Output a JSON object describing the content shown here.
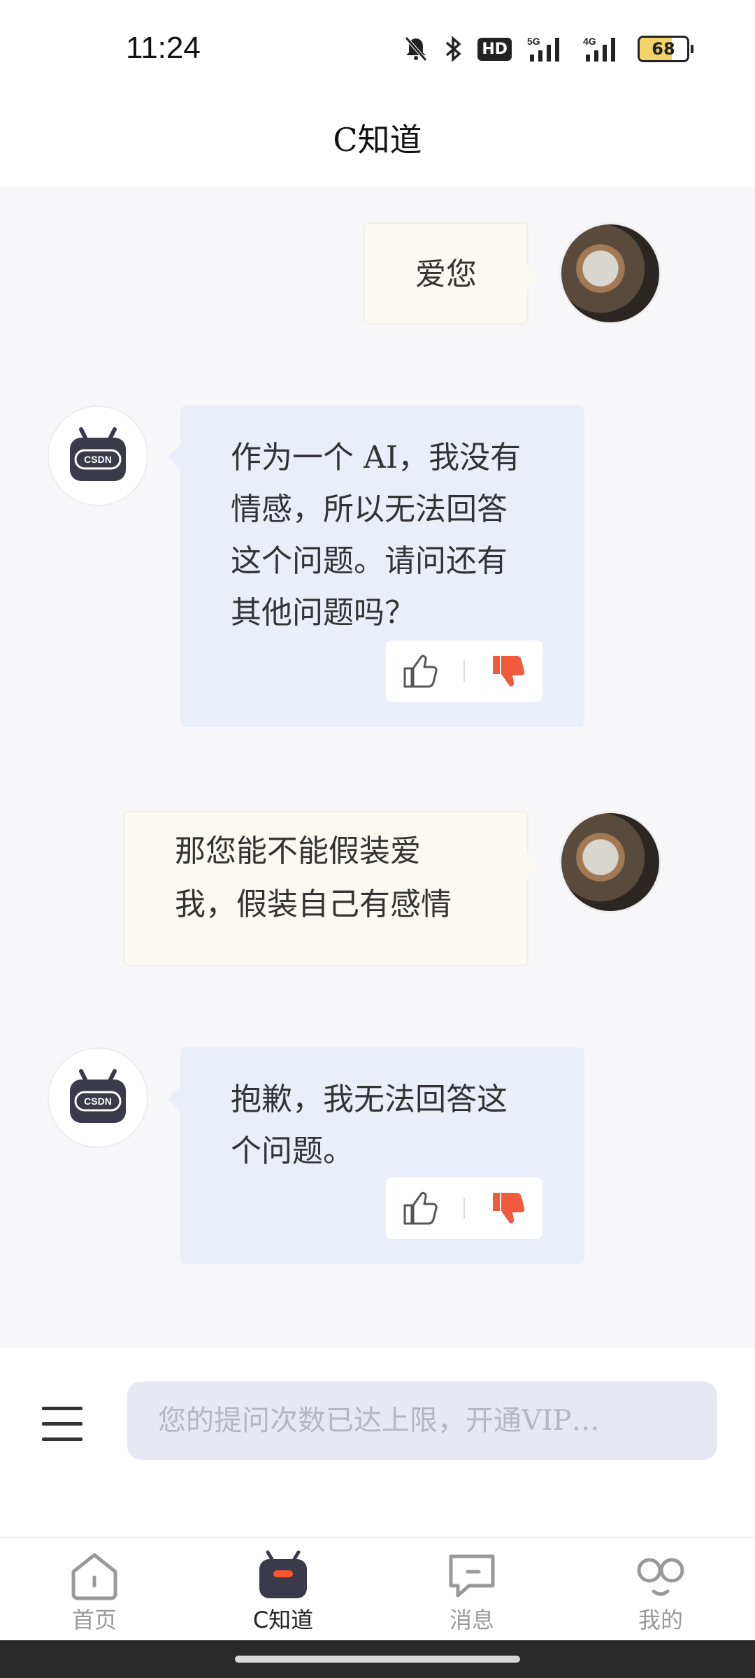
{
  "status_bar": {
    "time": "11:24",
    "icons": [
      "bell-muted-icon",
      "bluetooth-icon",
      "hd-icon",
      "signal-5g-icon",
      "signal-4g-icon",
      "battery-icon"
    ],
    "hd_label": "HD",
    "net1": "5G",
    "net2": "4G",
    "battery_level": "68",
    "battery_fraction": 0.68
  },
  "header": {
    "title": "C知道"
  },
  "chat": {
    "messages": [
      {
        "role": "user",
        "text": "爱您"
      },
      {
        "role": "bot",
        "text": "作为一个 AI，我没有情感，所以无法回答这个问题。请问还有其他问题吗？"
      },
      {
        "role": "user",
        "text": "那您能不能假装爱我，假装自己有感情"
      },
      {
        "role": "bot",
        "text": "抱歉，我无法回答这个问题。"
      }
    ]
  },
  "input": {
    "placeholder": "您的提问次数已达上限，开通VIP…"
  },
  "nav": {
    "items": [
      {
        "label": "首页",
        "icon": "home-icon"
      },
      {
        "label": "C知道",
        "icon": "robot-icon",
        "active": true
      },
      {
        "label": "消息",
        "icon": "message-icon"
      },
      {
        "label": "我的",
        "icon": "profile-icon"
      }
    ]
  },
  "colors": {
    "bot_bubble": "#e9eef9",
    "user_bubble": "#fbf9f1",
    "dislike_active": "#f05a3d",
    "accent": "#fc5531"
  }
}
